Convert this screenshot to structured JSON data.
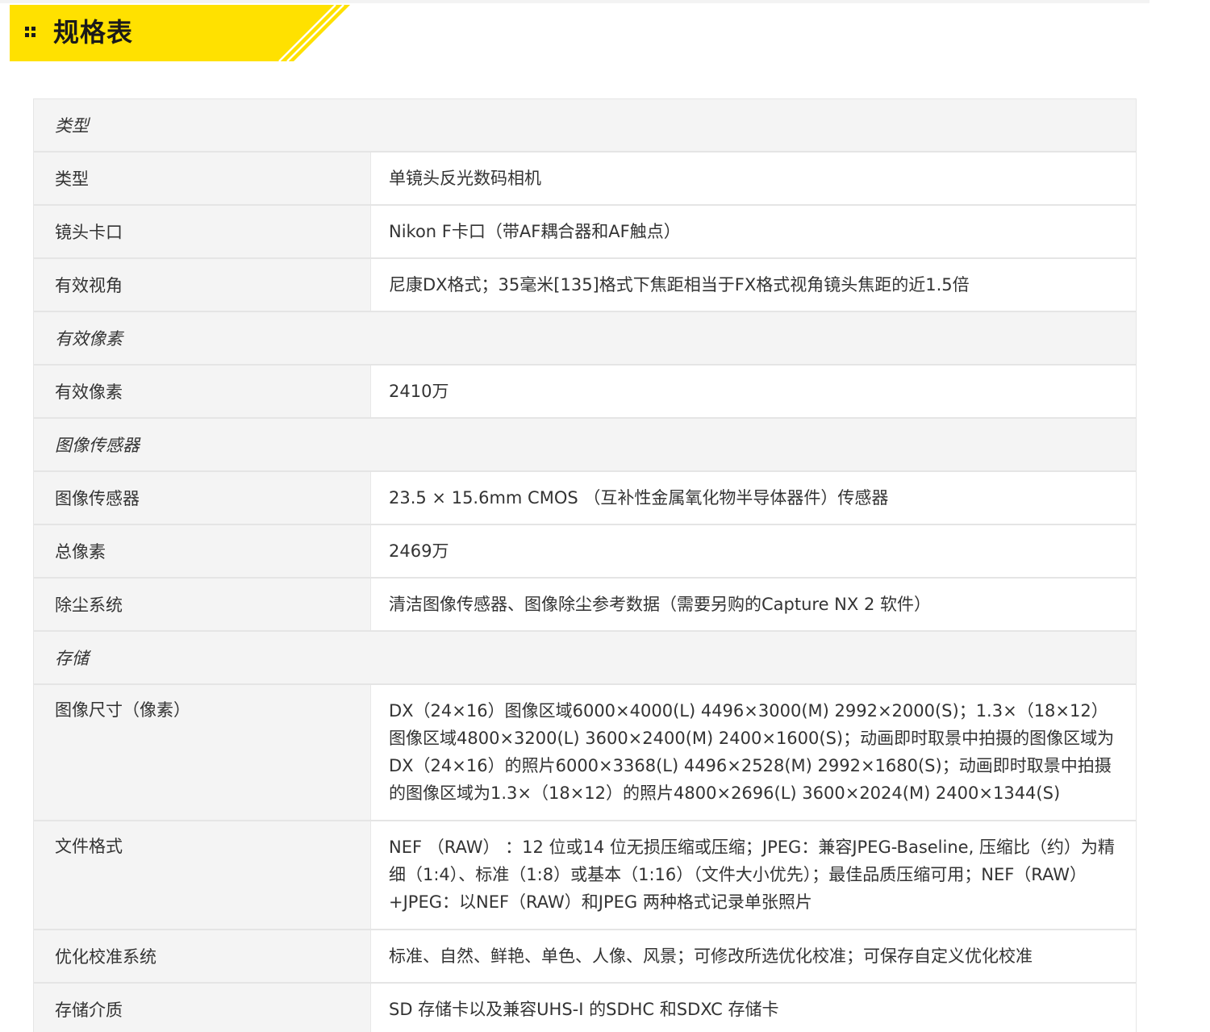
{
  "header": {
    "title": "规格表",
    "accent_color": "#ffe100",
    "icon": "grid-dots-icon"
  },
  "sections": [
    {
      "title": "类型",
      "rows": [
        {
          "label": "类型",
          "value": "单镜头反光数码相机"
        },
        {
          "label": "镜头卡口",
          "value": "Nikon F卡口（带AF耦合器和AF触点）"
        },
        {
          "label": "有效视角",
          "value": "尼康DX格式；35毫米[135]格式下焦距相当于FX格式视角镜头焦距的近1.5倍"
        }
      ]
    },
    {
      "title": "有效像素",
      "rows": [
        {
          "label": "有效像素",
          "value": "2410万"
        }
      ]
    },
    {
      "title": "图像传感器",
      "rows": [
        {
          "label": "图像传感器",
          "value": "23.5 × 15.6mm CMOS （互补性金属氧化物半导体器件）传感器"
        },
        {
          "label": "总像素",
          "value": "2469万"
        },
        {
          "label": "除尘系统",
          "value": "清洁图像传感器、图像除尘参考数据（需要另购的Capture NX 2 软件）"
        }
      ]
    },
    {
      "title": "存储",
      "rows": [
        {
          "label": "图像尺寸（像素）",
          "value": "DX（24×16）图像区域6000×4000(L) 4496×3000(M) 2992×2000(S)；1.3×（18×12）图像区域4800×3200(L) 3600×2400(M) 2400×1600(S)；动画即时取景中拍摄的图像区域为DX（24×16）的照片6000×3368(L) 4496×2528(M) 2992×1680(S)；动画即时取景中拍摄的图像区域为1.3×（18×12）的照片4800×2696(L) 3600×2024(M) 2400×1344(S)"
        },
        {
          "label": "文件格式",
          "value": "NEF （RAW） ：12 位或14 位无损压缩或压缩；JPEG：兼容JPEG-Baseline, 压缩比（约）为精细（1:4）、标准（1:8）或基本（1:16）（文件大小优先）；最佳品质压缩可用；NEF（RAW）+JPEG：以NEF（RAW）和JPEG 两种格式记录单张照片"
        },
        {
          "label": "优化校准系统",
          "value": "标准、自然、鲜艳、单色、人像、风景；可修改所选优化校准；可保存自定义优化校准"
        },
        {
          "label": "存储介质",
          "value": "SD 存储卡以及兼容UHS-I 的SDHC 和SDXC 存储卡"
        }
      ]
    }
  ]
}
